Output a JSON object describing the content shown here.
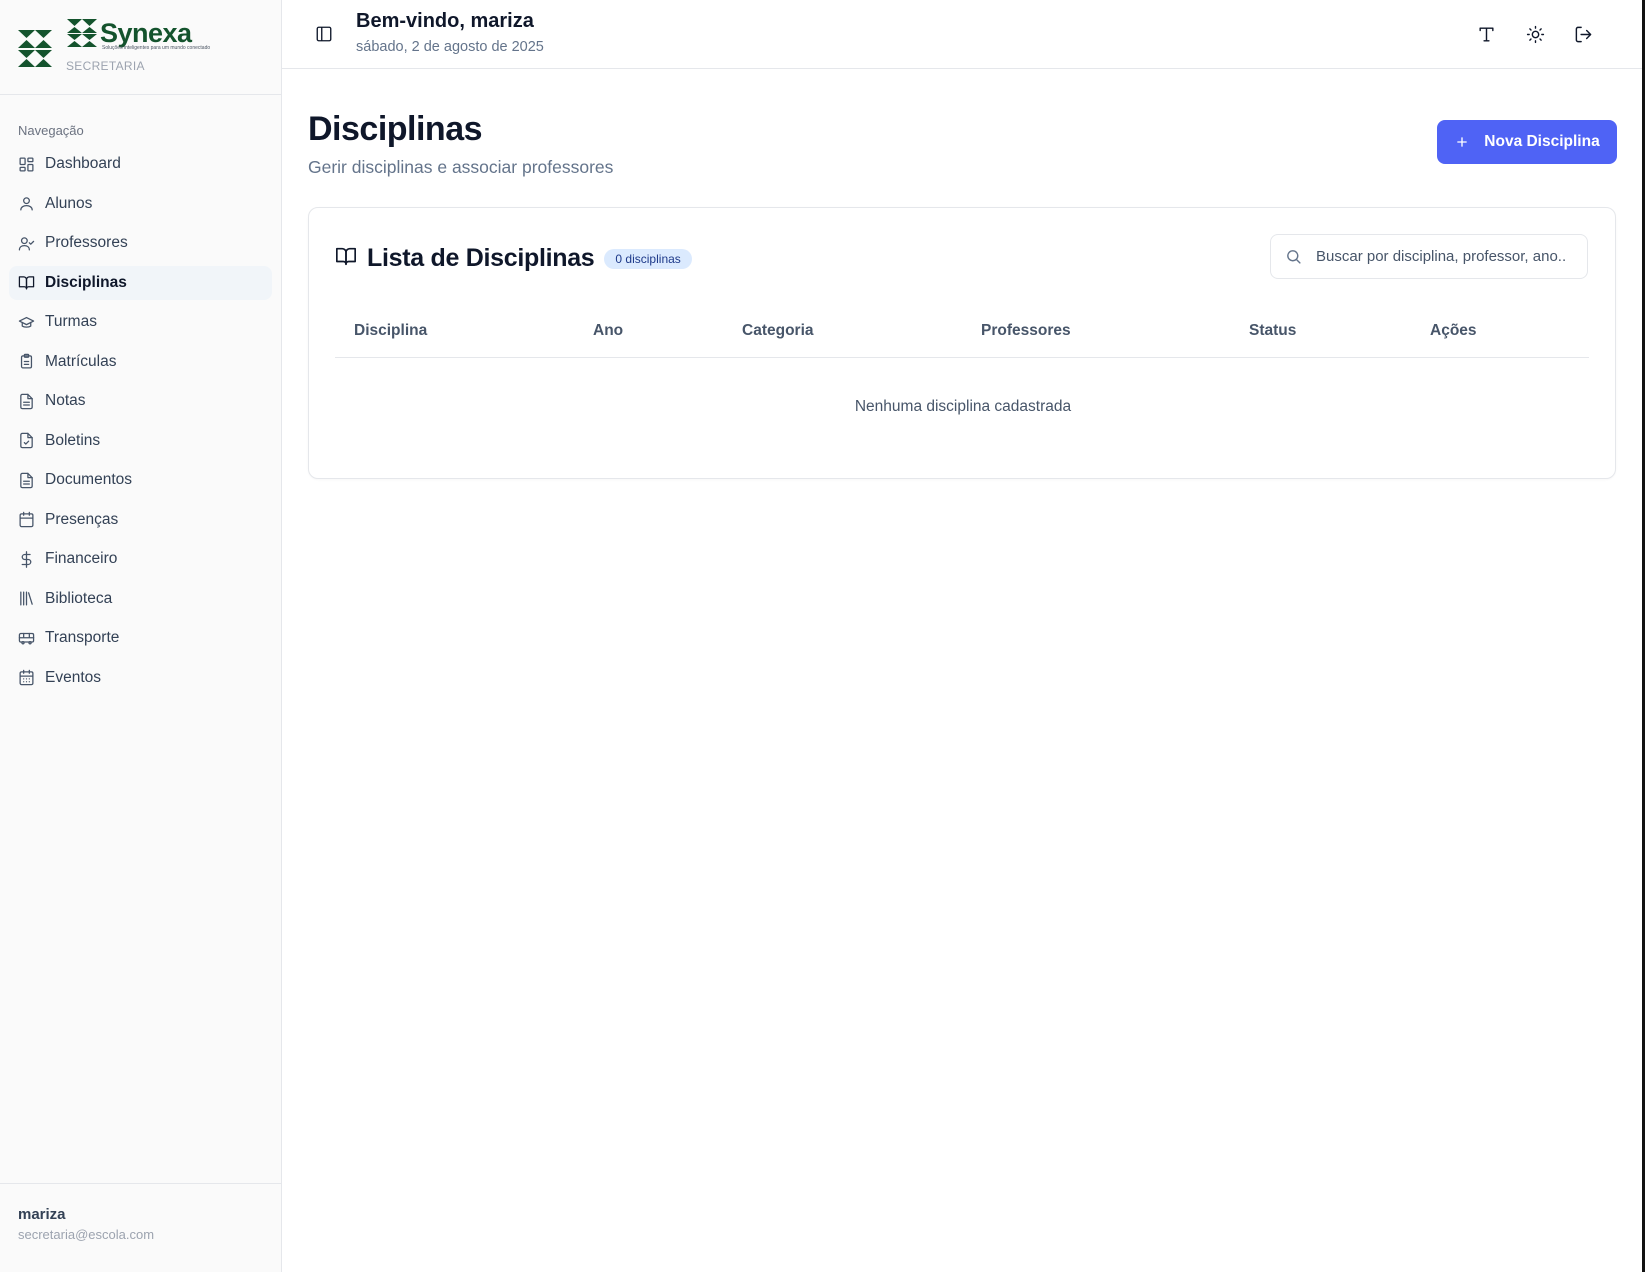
{
  "brand": {
    "name": "Synexa",
    "tagline": "Soluções inteligentes para um mundo conectado",
    "role": "SECRETARIA"
  },
  "sidebar": {
    "section_label": "Navegação",
    "items": [
      {
        "label": "Dashboard",
        "icon": "layout-dashboard-icon"
      },
      {
        "label": "Alunos",
        "icon": "user-icon"
      },
      {
        "label": "Professores",
        "icon": "user-check-icon"
      },
      {
        "label": "Disciplinas",
        "icon": "book-open-icon",
        "active": true
      },
      {
        "label": "Turmas",
        "icon": "graduation-cap-icon"
      },
      {
        "label": "Matrículas",
        "icon": "clipboard-icon"
      },
      {
        "label": "Notas",
        "icon": "file-text-icon"
      },
      {
        "label": "Boletins",
        "icon": "file-check-icon"
      },
      {
        "label": "Documentos",
        "icon": "file-text-icon"
      },
      {
        "label": "Presenças",
        "icon": "calendar-icon"
      },
      {
        "label": "Financeiro",
        "icon": "dollar-icon"
      },
      {
        "label": "Biblioteca",
        "icon": "library-icon"
      },
      {
        "label": "Transporte",
        "icon": "bus-icon"
      },
      {
        "label": "Eventos",
        "icon": "calendar-days-icon"
      }
    ],
    "user": {
      "name": "mariza",
      "email": "secretaria@escola.com"
    }
  },
  "header": {
    "welcome": "Bem-vindo, mariza",
    "date": "sábado, 2 de agosto de 2025"
  },
  "page": {
    "title": "Disciplinas",
    "subtitle": "Gerir disciplinas e associar professores",
    "new_button": "Nova Disciplina"
  },
  "list": {
    "title": "Lista de Disciplinas",
    "badge": "0 disciplinas",
    "search_placeholder": "Buscar por disciplina, professor, ano...",
    "columns": [
      "Disciplina",
      "Ano",
      "Categoria",
      "Professores",
      "Status",
      "Ações"
    ],
    "empty_message": "Nenhuma disciplina cadastrada"
  },
  "colors": {
    "primary": "#4f63f5",
    "brand_green": "#14532d",
    "badge_bg": "#dbeafe"
  }
}
